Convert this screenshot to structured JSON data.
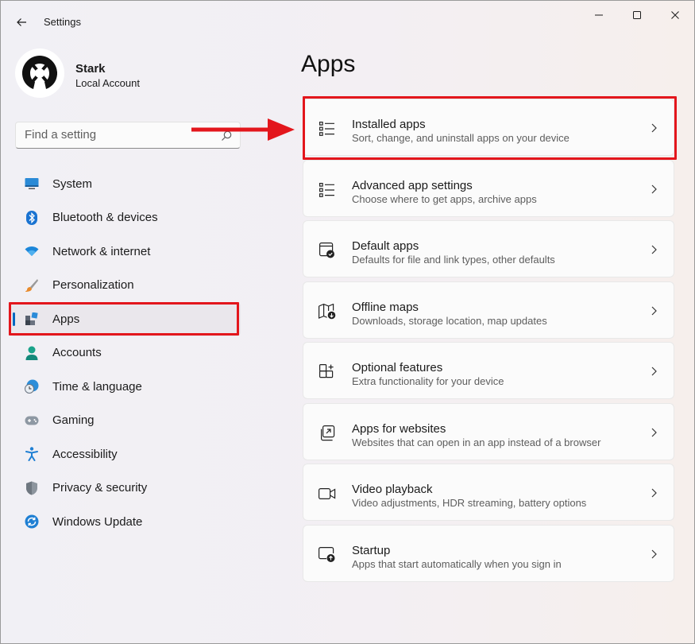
{
  "window": {
    "title": "Settings"
  },
  "profile": {
    "name": "Stark",
    "account_type": "Local Account"
  },
  "search": {
    "placeholder": "Find a setting"
  },
  "sidebar": {
    "items": [
      {
        "label": "System",
        "icon": "system-icon",
        "active": false
      },
      {
        "label": "Bluetooth & devices",
        "icon": "bluetooth-icon",
        "active": false
      },
      {
        "label": "Network & internet",
        "icon": "wifi-icon",
        "active": false
      },
      {
        "label": "Personalization",
        "icon": "brush-icon",
        "active": false
      },
      {
        "label": "Apps",
        "icon": "apps-icon",
        "active": true
      },
      {
        "label": "Accounts",
        "icon": "accounts-icon",
        "active": false
      },
      {
        "label": "Time & language",
        "icon": "time-language-icon",
        "active": false
      },
      {
        "label": "Gaming",
        "icon": "gamepad-icon",
        "active": false
      },
      {
        "label": "Accessibility",
        "icon": "accessibility-icon",
        "active": false
      },
      {
        "label": "Privacy & security",
        "icon": "shield-icon",
        "active": false
      },
      {
        "label": "Windows Update",
        "icon": "update-icon",
        "active": false
      }
    ]
  },
  "main": {
    "title": "Apps",
    "cards": [
      {
        "title": "Installed apps",
        "description": "Sort, change, and uninstall apps on your device",
        "icon": "installed-apps-icon"
      },
      {
        "title": "Advanced app settings",
        "description": "Choose where to get apps, archive apps",
        "icon": "advanced-app-settings-icon"
      },
      {
        "title": "Default apps",
        "description": "Defaults for file and link types, other defaults",
        "icon": "default-apps-icon"
      },
      {
        "title": "Offline maps",
        "description": "Downloads, storage location, map updates",
        "icon": "offline-maps-icon"
      },
      {
        "title": "Optional features",
        "description": "Extra functionality for your device",
        "icon": "optional-features-icon"
      },
      {
        "title": "Apps for websites",
        "description": "Websites that can open in an app instead of a browser",
        "icon": "apps-for-websites-icon"
      },
      {
        "title": "Video playback",
        "description": "Video adjustments, HDR streaming, battery options",
        "icon": "video-playback-icon"
      },
      {
        "title": "Startup",
        "description": "Apps that start automatically when you sign in",
        "icon": "startup-icon"
      }
    ]
  },
  "annotations": {
    "highlight_color": "#e3161c",
    "accent_color": "#0067c0"
  }
}
